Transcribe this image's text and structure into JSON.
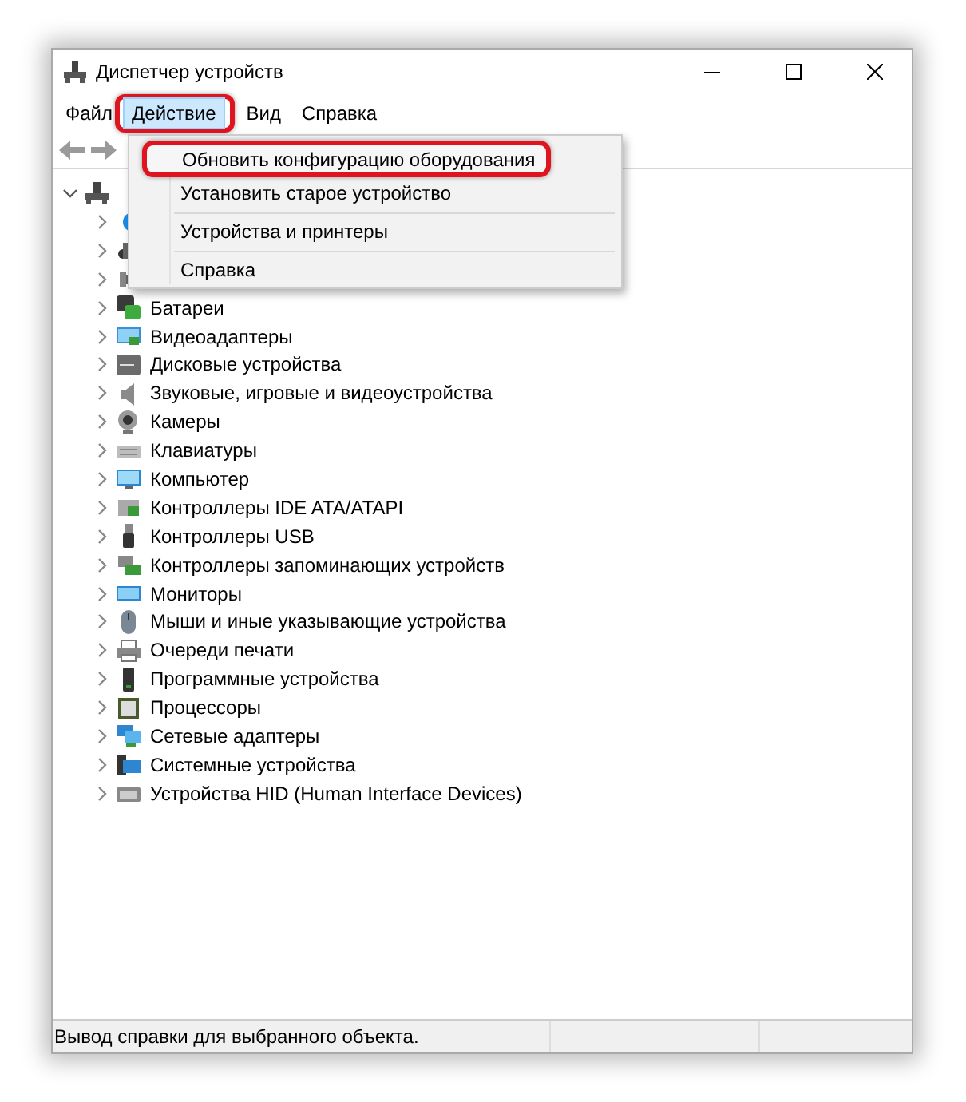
{
  "window": {
    "title": "Диспетчер устройств"
  },
  "menu_bar": [
    {
      "label": "Файл",
      "selected": false,
      "highlighted": false
    },
    {
      "label": "Действие",
      "selected": true,
      "highlighted": true
    },
    {
      "label": "Вид",
      "selected": false,
      "highlighted": false
    },
    {
      "label": "Справка",
      "selected": false,
      "highlighted": false
    }
  ],
  "action_menu": {
    "items": [
      {
        "kind": "item",
        "label": "Обновить конфигурацию оборудования",
        "highlighted": true
      },
      {
        "kind": "item",
        "label": "Установить старое устройство",
        "highlighted": false
      },
      {
        "kind": "separator"
      },
      {
        "kind": "item",
        "label": "Устройства и принтеры",
        "highlighted": false
      },
      {
        "kind": "separator"
      },
      {
        "kind": "item",
        "label": "Справка",
        "highlighted": false
      }
    ]
  },
  "tree": {
    "expanded": true,
    "children": [
      {
        "kind": "covered",
        "expanded": false
      },
      {
        "kind": "covered",
        "expanded": false
      },
      {
        "kind": "covered",
        "expanded": false
      },
      {
        "kind": "node",
        "label": "Батареи",
        "expanded": false
      },
      {
        "kind": "node",
        "label": "Видеоадаптеры",
        "expanded": false
      },
      {
        "kind": "node",
        "label": "Дисковые устройства",
        "expanded": false
      },
      {
        "kind": "node",
        "label": "Звуковые, игровые и видеоустройства",
        "expanded": false
      },
      {
        "kind": "node",
        "label": "Камеры",
        "expanded": false
      },
      {
        "kind": "node",
        "label": "Клавиатуры",
        "expanded": false
      },
      {
        "kind": "node",
        "label": "Компьютер",
        "expanded": false
      },
      {
        "kind": "node",
        "label": "Контроллеры IDE ATA/ATAPI",
        "expanded": false
      },
      {
        "kind": "node",
        "label": "Контроллеры USB",
        "expanded": false
      },
      {
        "kind": "node",
        "label": "Контроллеры запоминающих устройств",
        "expanded": false
      },
      {
        "kind": "node",
        "label": "Мониторы",
        "expanded": false
      },
      {
        "kind": "node",
        "label": "Мыши и иные указывающие устройства",
        "expanded": false
      },
      {
        "kind": "node",
        "label": "Очереди печати",
        "expanded": false
      },
      {
        "kind": "node",
        "label": "Программные устройства",
        "expanded": false
      },
      {
        "kind": "node",
        "label": "Процессоры",
        "expanded": false
      },
      {
        "kind": "node",
        "label": "Сетевые адаптеры",
        "expanded": false
      },
      {
        "kind": "node",
        "label": "Системные устройства",
        "expanded": false
      },
      {
        "kind": "node",
        "label": "Устройства HID (Human Interface Devices)",
        "expanded": false
      }
    ]
  },
  "status_bar": {
    "text": "Вывод справки для выбранного объекта."
  }
}
